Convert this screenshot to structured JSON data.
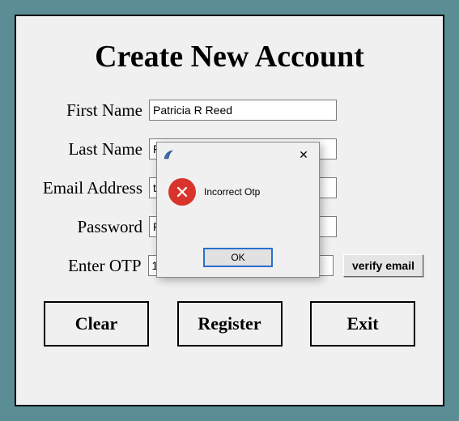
{
  "title": "Create New Account",
  "labels": {
    "first_name": "First Name",
    "last_name": "Last Name",
    "email": "Email Address",
    "password": "Password",
    "otp": "Enter OTP"
  },
  "values": {
    "first_name": "Patricia R Reed",
    "last_name": "R",
    "email": "to",
    "password": "R",
    "otp": "1"
  },
  "buttons": {
    "verify": "verify email",
    "clear": "Clear",
    "register": "Register",
    "exit": "Exit"
  },
  "dialog": {
    "message": "Incorrect Otp",
    "ok": "OK",
    "close": "✕"
  }
}
